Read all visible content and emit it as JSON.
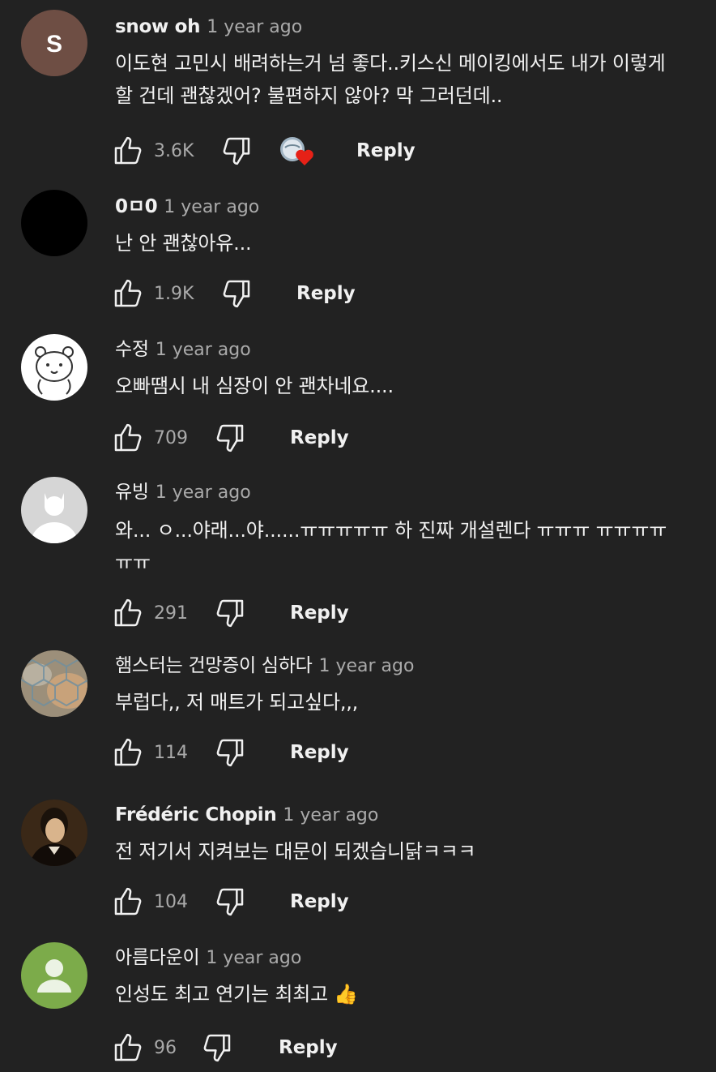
{
  "comments": [
    {
      "author": "snow oh",
      "time": "1 year ago",
      "text": "이도현 고민시 배려하는거 넘 좋다..키스신 메이킹에서도 내가 이렇게 할 건데 괜찮겠어? 불편하지 않아? 막 그러던데..",
      "likes": "3.6K",
      "reply": "Reply",
      "avatar_letter": "S",
      "creator_hearted": true
    },
    {
      "author": "0ㅁ0",
      "time": "1 year ago",
      "text": "난 안 괜찮아유...",
      "likes": "1.9K",
      "reply": "Reply"
    },
    {
      "author": "수정",
      "time": "1 year ago",
      "text": "오빠땜시 내 심장이 안 괜차네요....",
      "likes": "709",
      "reply": "Reply"
    },
    {
      "author": "유빙",
      "time": "1 year ago",
      "text": "와... ㅇ...야래...야......ㅠㅠㅠㅠㅠ 하 진짜 개설렌다 ㅠㅠㅠ ㅠㅠㅠㅠㅠㅠ",
      "likes": "291",
      "reply": "Reply"
    },
    {
      "author": "햄스터는 건망증이 심하다",
      "time": "1 year ago",
      "text": "부럽다,, 저 매트가 되고싶다,,,",
      "likes": "114",
      "reply": "Reply"
    },
    {
      "author": "Frédéric Chopin",
      "time": "1 year ago",
      "text": "전 저기서 지켜보는 대문이 되겠습니닭ㅋㅋㅋ",
      "likes": "104",
      "reply": "Reply"
    },
    {
      "author": "아름다운이",
      "time": "1 year ago",
      "text": "인성도 최고 연기는 최최고 👍",
      "likes": "96",
      "reply": "Reply"
    }
  ],
  "colors": {
    "background": "#222222",
    "text": "#f1f1f1",
    "secondary": "#aaaaaa",
    "heart": "#e62117"
  }
}
